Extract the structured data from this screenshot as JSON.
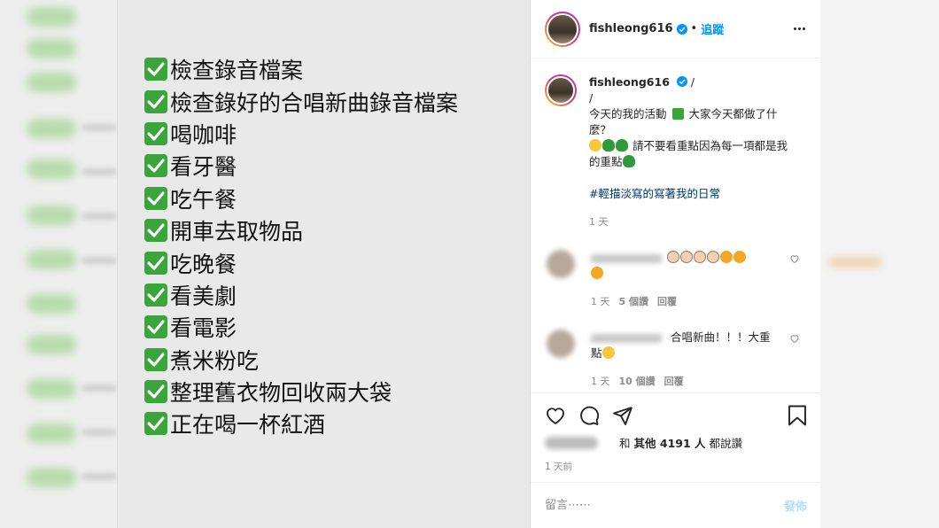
{
  "post": {
    "username": "fishleong616",
    "follow_label": "追蹤",
    "dot": "•",
    "checklist": [
      "檢查錄音檔案",
      "檢查錄好的合唱新曲錄音檔案",
      "喝咖啡",
      "看牙醫",
      "吃午餐",
      "開車去取物品",
      "吃晚餐",
      "看美劇",
      "看電影",
      "煮米粉吃",
      "整理舊衣物回收兩大袋",
      "正在喝一杯紅酒"
    ]
  },
  "caption": {
    "username": "fishleong616",
    "slash1": "/",
    "slash2": "/",
    "line1": "今天的我的活動",
    "line1b": "大家今天都做了什麼？",
    "line2": "請不要看重點因為每一項都是我的重點",
    "hashtag": "#輕描淡寫的寫著我的日常",
    "time": "1 天"
  },
  "comments": [
    {
      "text": "",
      "time": "1 天",
      "likes": "5 個讚",
      "reply": "回覆"
    },
    {
      "text": "合唱新曲！！！大重點",
      "time": "1 天",
      "likes": "10 個讚",
      "reply": "回覆"
    }
  ],
  "likes": {
    "and": "和",
    "others": "其他 4191 人",
    "suffix": "都說讚"
  },
  "time_ago": "1 天前",
  "comment_input": {
    "placeholder": "留言⋯⋯",
    "post_label": "發佈"
  },
  "colors": {
    "accent": "#0095f6",
    "check": "#3aa53a",
    "post_disabled": "#b2dffc"
  }
}
